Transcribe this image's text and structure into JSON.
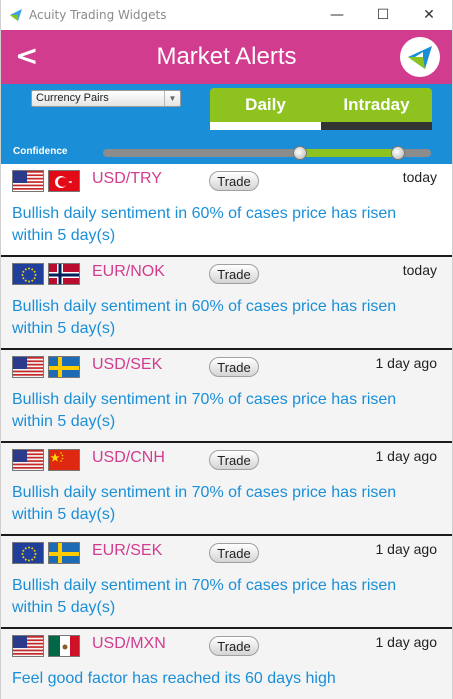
{
  "window": {
    "title": "Acuity Trading Widgets",
    "minimize": "—",
    "maximize": "☐",
    "close": "✕"
  },
  "header": {
    "back": "<",
    "title": "Market Alerts",
    "accent": "#d23c8f"
  },
  "controls": {
    "select_value": "Currency Pairs",
    "tabs": [
      {
        "label": "Daily",
        "active": true
      },
      {
        "label": "Intraday",
        "active": false
      }
    ],
    "confidence_label": "Confidence",
    "slider": {
      "low": 0.6,
      "high": 0.9
    }
  },
  "alerts": [
    {
      "pair": "USD/TRY",
      "trade": "Trade",
      "time": "today",
      "message": "Bullish daily sentiment in 60% of cases price has risen within 5 day(s)",
      "flags": [
        "us",
        "tr"
      ]
    },
    {
      "pair": "EUR/NOK",
      "trade": "Trade",
      "time": "today",
      "message": "Bullish daily sentiment in 60% of cases price has risen within 5 day(s)",
      "flags": [
        "eu",
        "no"
      ]
    },
    {
      "pair": "USD/SEK",
      "trade": "Trade",
      "time": "1 day ago",
      "message": "Bullish daily sentiment in 70% of cases price has risen within 5 day(s)",
      "flags": [
        "us",
        "se"
      ]
    },
    {
      "pair": "USD/CNH",
      "trade": "Trade",
      "time": "1 day ago",
      "message": "Bullish daily sentiment in 70% of cases price has risen within 5 day(s)",
      "flags": [
        "us",
        "cn"
      ]
    },
    {
      "pair": "EUR/SEK",
      "trade": "Trade",
      "time": "1 day ago",
      "message": "Bullish daily sentiment in 70% of cases price has risen within 5 day(s)",
      "flags": [
        "eu",
        "se"
      ]
    },
    {
      "pair": "USD/MXN",
      "trade": "Trade",
      "time": "1 day ago",
      "message": "Feel good factor has reached its 60 days high",
      "flags": [
        "us",
        "mx"
      ]
    }
  ]
}
